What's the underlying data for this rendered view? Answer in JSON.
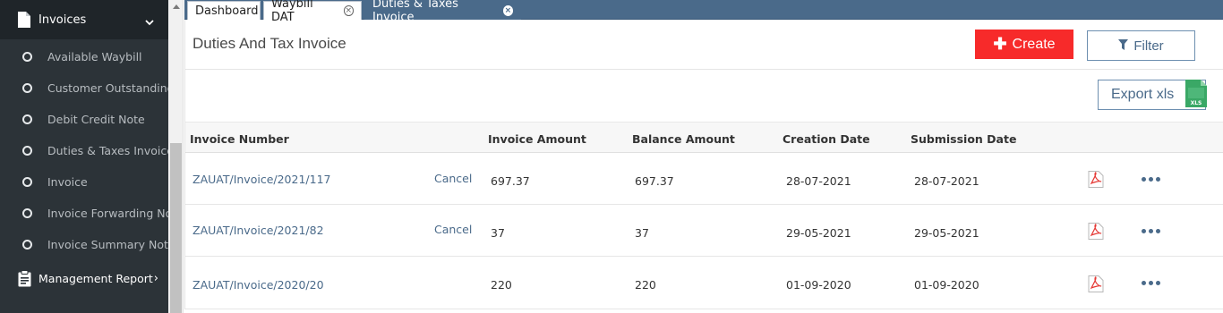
{
  "sidebar": {
    "group_label": "Invoices",
    "items": [
      {
        "label": "Available Waybill"
      },
      {
        "label": "Customer Outstanding"
      },
      {
        "label": "Debit Credit Note"
      },
      {
        "label": "Duties & Taxes Invoice"
      },
      {
        "label": "Invoice"
      },
      {
        "label": "Invoice Forwarding Note"
      },
      {
        "label": "Invoice Summary Note"
      }
    ],
    "management_label": "Management Report",
    "management_arrow": "›"
  },
  "tabs": [
    {
      "label": "Dashboard"
    },
    {
      "label": "Waybill DAT",
      "close": "×"
    },
    {
      "label": "Duties & Taxes Invoice",
      "close": "×"
    }
  ],
  "page": {
    "title": "Duties And Tax Invoice",
    "create_label": "Create",
    "filter_label": "Filter",
    "export_label": "Export xls",
    "xls_badge": "XLS"
  },
  "table": {
    "headers": [
      "Invoice Number",
      "Invoice Amount",
      "Balance Amount",
      "Creation Date",
      "Submission Date"
    ],
    "rows": [
      {
        "invoice_number": "ZAUAT/Invoice/2021/117",
        "action": "Cancel",
        "invoice_amount": "697.37",
        "balance_amount": "697.37",
        "creation_date": "28-07-2021",
        "submission_date": "28-07-2021"
      },
      {
        "invoice_number": "ZAUAT/Invoice/2021/82",
        "action": "Cancel",
        "invoice_amount": "37",
        "balance_amount": "37",
        "creation_date": "29-05-2021",
        "submission_date": "29-05-2021"
      },
      {
        "invoice_number": "ZAUAT/Invoice/2020/20",
        "action": "",
        "invoice_amount": "220",
        "balance_amount": "220",
        "creation_date": "01-09-2020",
        "submission_date": "01-09-2020"
      }
    ]
  },
  "colors": {
    "sidebar_bg": "#2c3338",
    "accent": "#4a6a8a",
    "create_red": "#f72a2a"
  },
  "icons": {
    "sidebar_group": "document-icon",
    "sidebar_group_toggle": "chevron-down-icon",
    "management": "clipboard-icon",
    "create": "plus-icon",
    "filter": "funnel-icon",
    "export": "xls-file-icon",
    "row_pdf": "pdf-icon",
    "row_more": "more-dots-icon"
  }
}
